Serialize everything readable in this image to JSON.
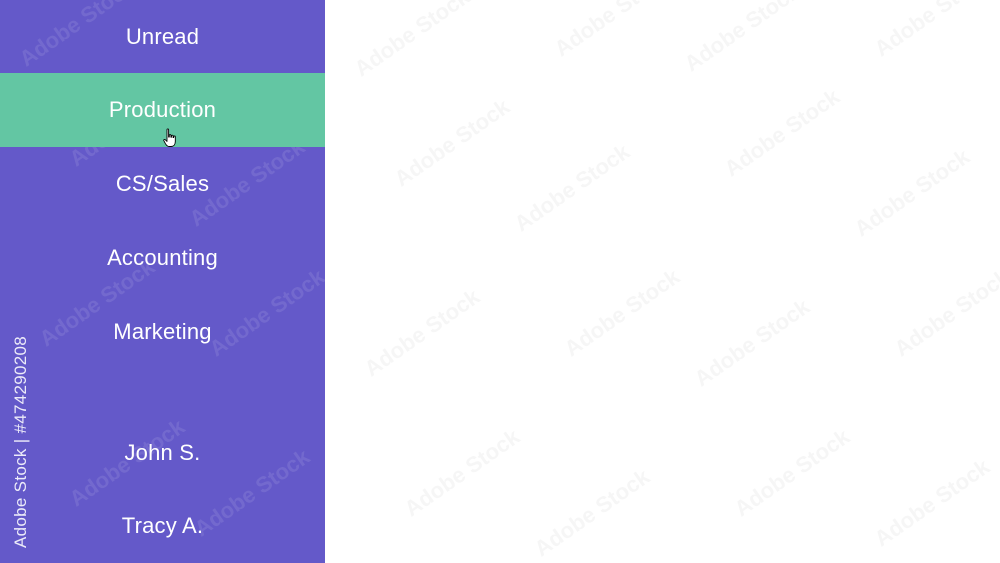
{
  "sidebar": {
    "items": [
      {
        "label": "Unread",
        "active": false
      },
      {
        "label": "Production",
        "active": true
      },
      {
        "label": "CS/Sales",
        "active": false
      },
      {
        "label": "Accounting",
        "active": false
      },
      {
        "label": "Marketing",
        "active": false
      },
      {
        "label": "John S.",
        "active": false
      },
      {
        "label": "Tracy A.",
        "active": false
      }
    ]
  },
  "watermark": {
    "vertical_text": "Adobe Stock | #474290208",
    "tile_text": "Adobe Stock"
  },
  "colors": {
    "sidebar_bg": "#6459c9",
    "active_bg": "#63c6a3",
    "content_bg": "#ffffff",
    "text": "#ffffff"
  },
  "icons": {
    "cursor": "hand-pointer-icon"
  }
}
